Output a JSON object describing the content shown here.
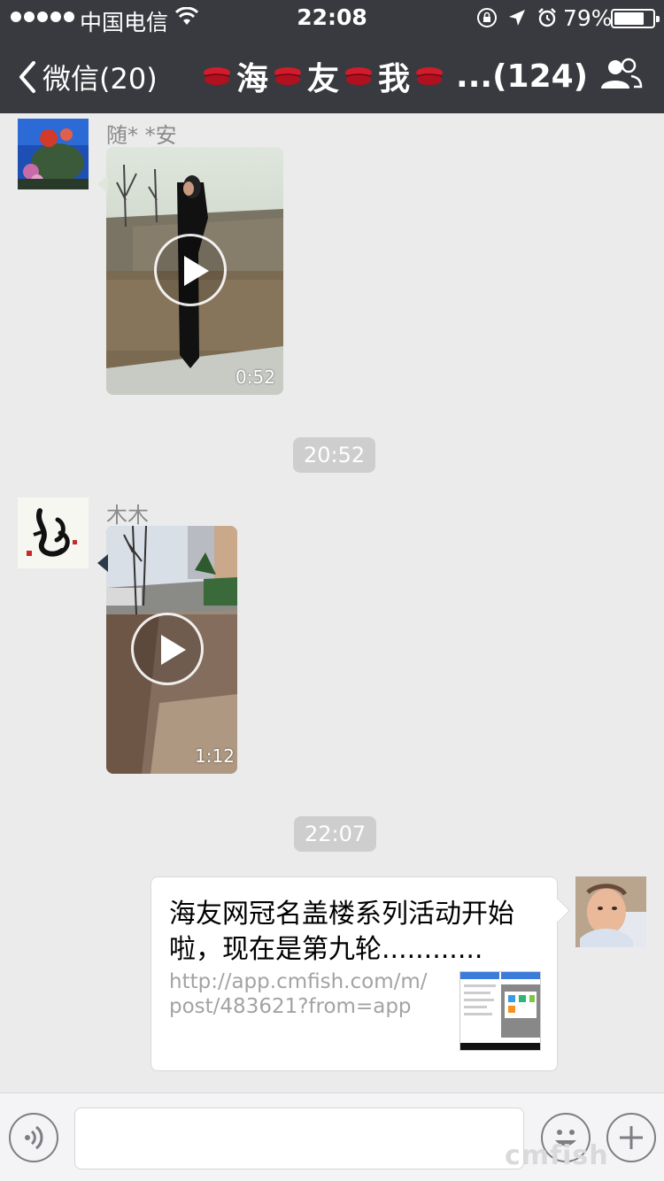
{
  "status_bar": {
    "carrier": "中国电信",
    "time": "22:08",
    "battery_percent": "79%",
    "battery_level": 0.79,
    "icons": [
      "signal-dots-icon",
      "wifi-icon",
      "rotation-lock-icon",
      "location-arrow-icon",
      "alarm-icon",
      "battery-icon"
    ]
  },
  "nav": {
    "back_label": "微信(20)",
    "title_chars": [
      "海",
      "友",
      "我"
    ],
    "title_suffix": "...(124)",
    "title_emoji": "kiss-lips-icon",
    "right_icon": "group-people-icon"
  },
  "messages": [
    {
      "sender": "随*  *安",
      "type": "video",
      "duration": "0:52"
    },
    {
      "timestamp": "20:52"
    },
    {
      "sender": "木木",
      "type": "video",
      "duration": "1:12"
    },
    {
      "timestamp": "22:07"
    },
    {
      "type": "link",
      "title": "海友网冠名盖楼系列活动开始啦，现在是第九轮............",
      "url": "http://app.cmfish.com/m/post/483621?from=app"
    }
  ],
  "input_bar": {
    "left_icon": "voice-icon",
    "emoji_icon": "smiley-icon",
    "plus_icon": "plus-icon",
    "input_value": ""
  },
  "watermark": "cmfish",
  "colors": {
    "nav_bg": "#393a3f",
    "chat_bg": "#ebebeb",
    "timestamp_bg": "#cecece",
    "sender_text": "#8b8b8b"
  }
}
